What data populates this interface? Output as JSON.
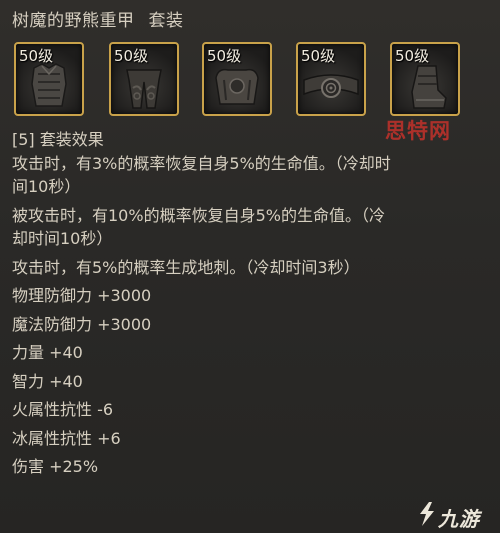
{
  "tooltip": {
    "item_name": "树魔的野熊重甲",
    "set_tag": "套装",
    "slots": [
      {
        "level": "50级",
        "icon": "chest-armor-icon"
      },
      {
        "level": "50级",
        "icon": "leg-armor-icon"
      },
      {
        "level": "50级",
        "icon": "shoulder-armor-icon"
      },
      {
        "level": "50级",
        "icon": "belt-icon"
      },
      {
        "level": "50级",
        "icon": "boots-icon"
      }
    ],
    "set_header": "[5] 套装效果",
    "effects": [
      "攻击时，有3%的概率恢复自身5%的生命值。（冷却时",
      "间10秒）",
      "被攻击时，有10%的概率恢复自身5%的生命值。（冷",
      "却时间10秒）",
      "攻击时，有5%的概率生成地刺。（冷却时间3秒）"
    ],
    "stats": [
      "物理防御力 +3000",
      "魔法防御力 +3000",
      "力量 +40",
      "智力 +40",
      "火属性抗性 -6",
      "冰属性抗性 +6",
      "伤害 +25%"
    ]
  },
  "watermarks": {
    "top": "思特网",
    "bottom": "九游"
  },
  "colors": {
    "background": "#2b2a28",
    "text": "#d6cfc0",
    "slot_border": "#c9a24a",
    "watermark_red": "#c8322b"
  }
}
